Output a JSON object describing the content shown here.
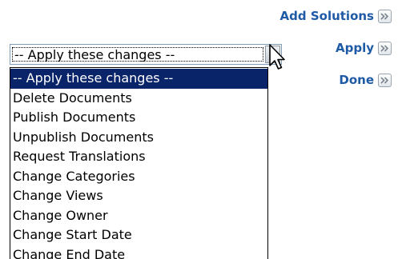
{
  "actions": {
    "add_solutions": "Add Solutions",
    "apply": "Apply",
    "done": "Done"
  },
  "select": {
    "value": "-- Apply these changes --",
    "options": [
      "-- Apply these changes --",
      "Delete Documents",
      "Publish Documents",
      "Unpublish Documents",
      "Request Translations",
      "Change Categories",
      "Change Views",
      "Change Owner",
      "Change Start Date",
      "Change End Date"
    ]
  },
  "colors": {
    "link": "#1f5aa6",
    "highlight": "#0a246a",
    "border": "#7f9db9"
  },
  "icons": {
    "go": "double-chevron-right-icon",
    "dropdown": "chevron-down-icon",
    "cursor": "mouse-pointer-icon"
  }
}
